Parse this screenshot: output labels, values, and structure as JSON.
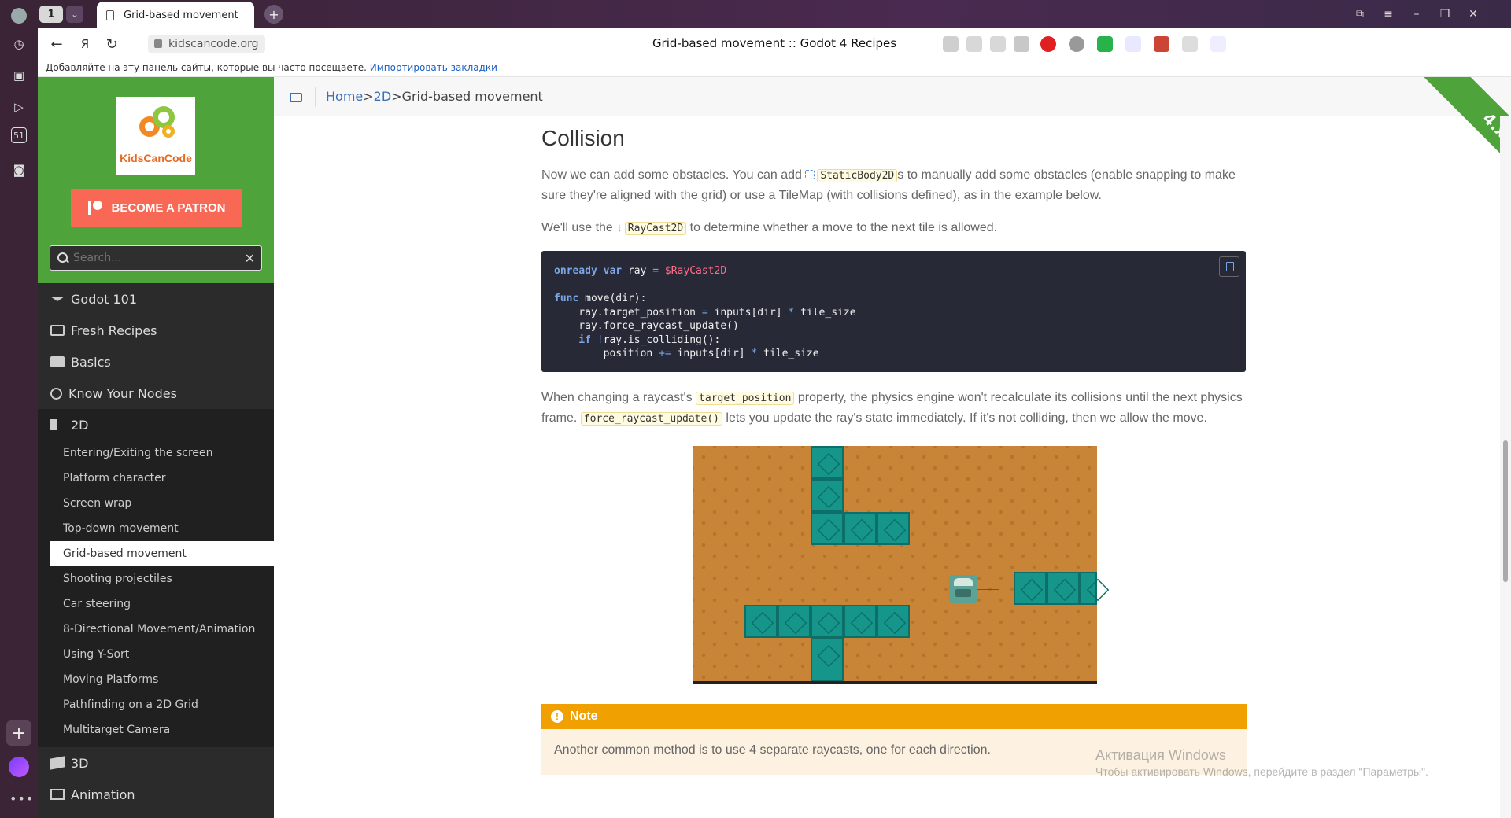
{
  "browser": {
    "tab_count": "1",
    "active_tab_title": "Grid-based movement :: Godot 4 Recipes",
    "url": "kidscancode.org",
    "page_title": "Grid-based movement :: Godot 4 Recipes",
    "bookmarks_hint": "Добавляйте на эту панель сайты, которые вы часто посещаете.",
    "bookmarks_import": "Импортировать закладки",
    "rail_badge": "51"
  },
  "sidebar": {
    "logo_text": "KidsCanCode",
    "patron_label": "BECOME A PATRON",
    "search_placeholder": "Search...",
    "top_items": [
      "Godot 101",
      "Fresh Recipes",
      "Basics",
      "Know Your Nodes",
      "2D"
    ],
    "sub_items": [
      "Entering/Exiting the screen",
      "Platform character",
      "Screen wrap",
      "Top-down movement",
      "Grid-based movement",
      "Shooting projectiles",
      "Car steering",
      "8-Directional Movement/Animation",
      "Using Y-Sort",
      "Moving Platforms",
      "Pathfinding on a 2D Grid",
      "Multitarget Camera"
    ],
    "bottom_items": [
      "3D",
      "Animation"
    ]
  },
  "breadcrumb": {
    "home": "Home",
    "sep": ">",
    "section": "2D",
    "current": "Grid-based movement"
  },
  "version_badge": "4.x",
  "content": {
    "heading": "Collision",
    "p1_a": "Now we can add some obstacles. You can add ",
    "p1_code": "StaticBody2D",
    "p1_b": "s to manually add some obstacles (enable snapping to make sure they're aligned with the grid) or use a TileMap (with collisions defined), as in the example below.",
    "p2_a": "We'll use the ",
    "p2_code": "RayCast2D",
    "p2_b": " to determine whether a move to the next tile is allowed.",
    "code": {
      "l1_kw": "onready var",
      "l1_txt": " ray ",
      "l1_op": "=",
      "l1_node": " $RayCast2D",
      "l2_kw": "func",
      "l2_txt": " move(dir):",
      "l3": "    ray.target_position ",
      "l3_op": "=",
      "l3_b": " inputs[dir] ",
      "l3_op2": "*",
      "l3_c": " tile_size",
      "l4": "    ray.force_raycast_update()",
      "l5_kw": "    if",
      "l5_op": " !",
      "l5_txt": "ray.is_colliding():",
      "l6": "        position ",
      "l6_op": "+=",
      "l6_b": " inputs[dir] ",
      "l6_op2": "*",
      "l6_c": " tile_size"
    },
    "p3_a": "When changing a raycast's ",
    "p3_code1": "target_position",
    "p3_b": " property, the physics engine won't recalculate its collisions until the next physics frame. ",
    "p3_code2": "force_raycast_update()",
    "p3_c": " lets you update the ray's state immediately. If it's not colliding, then we allow the move.",
    "note_title": "Note",
    "note_body": "Another common method is to use 4 separate raycasts, one for each direction."
  },
  "watermark": {
    "line1": "Активация Windows",
    "line2": "Чтобы активировать Windows, перейдите в раздел \"Параметры\"."
  },
  "colors": {
    "sidebar_green": "#4fa33b",
    "patron": "#f96854",
    "note": "#f0a000",
    "link": "#3a6fb7"
  }
}
